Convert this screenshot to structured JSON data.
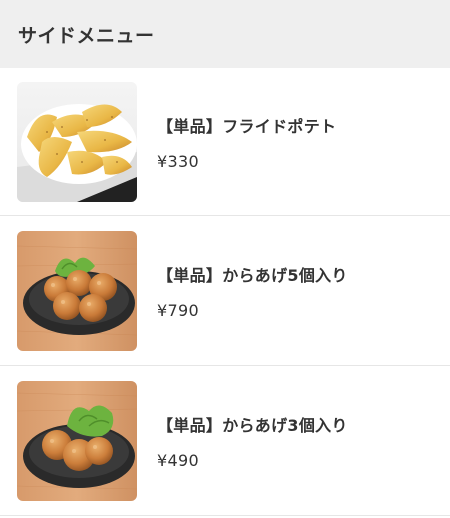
{
  "header": {
    "title": "サイドメニュー"
  },
  "items": [
    {
      "name": "【単品】フライドポテト",
      "price": "¥330",
      "image": "fried-potato-photo"
    },
    {
      "name": "【単品】からあげ5個入り",
      "price": "¥790",
      "image": "karaage-5-photo"
    },
    {
      "name": "【単品】からあげ3個入り",
      "price": "¥490",
      "image": "karaage-3-photo"
    }
  ],
  "colors": {
    "header_bg": "#efefef",
    "text": "#333333",
    "divider": "#e6e6e6"
  }
}
